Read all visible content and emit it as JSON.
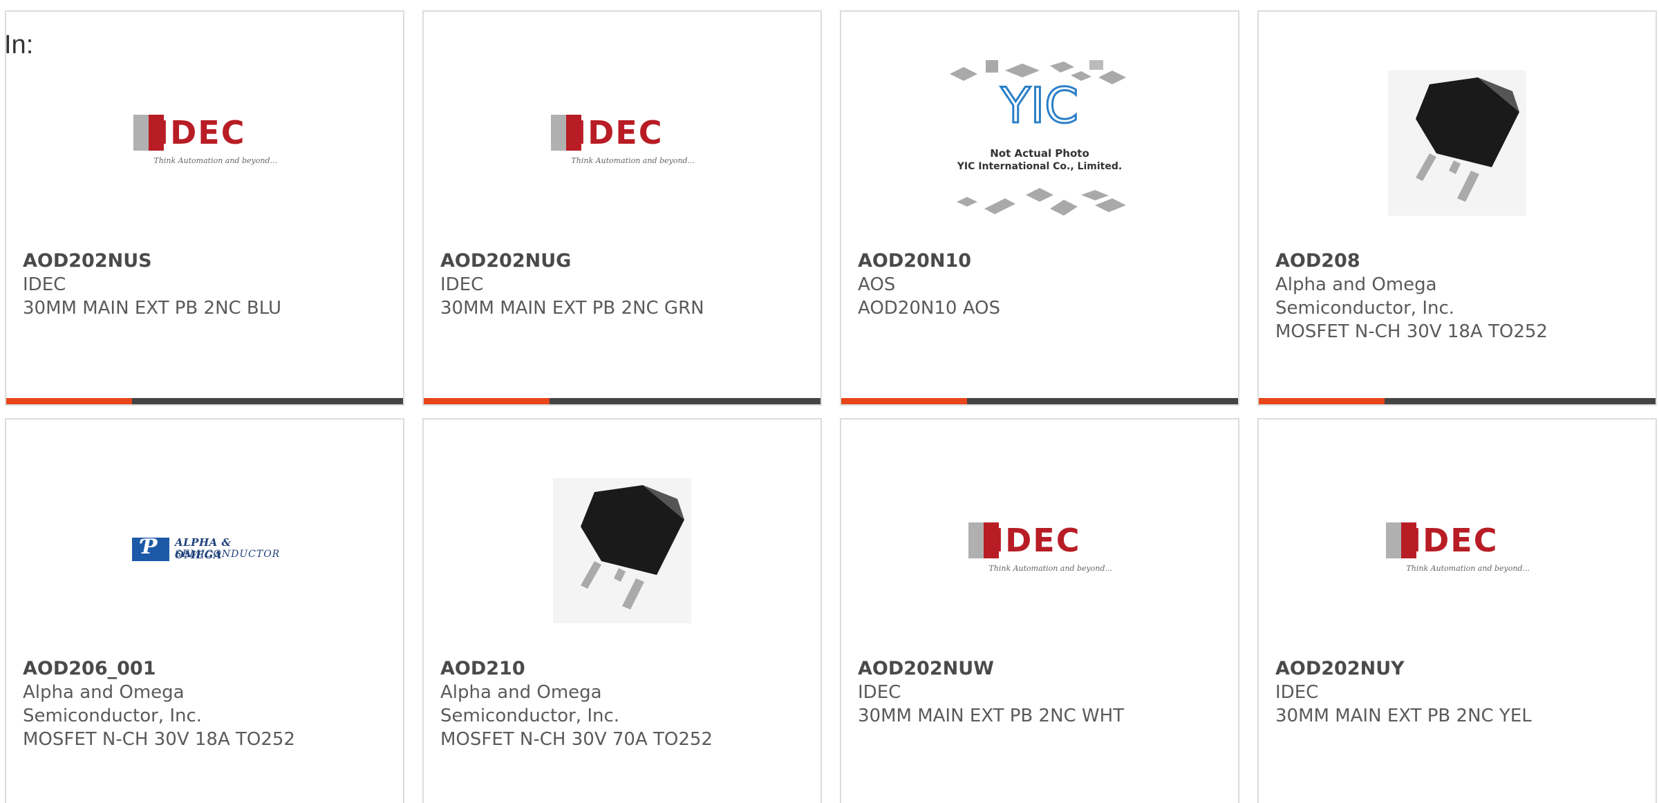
{
  "header": {
    "label": "In:"
  },
  "cards": [
    {
      "part": "AOD202NUS",
      "maker": "IDEC",
      "desc": "30MM MAIN EXT PB 2NC BLU",
      "image": "idec-logo"
    },
    {
      "part": "AOD202NUG",
      "maker": "IDEC",
      "desc": "30MM MAIN EXT PB 2NC GRN",
      "image": "idec-logo"
    },
    {
      "part": "AOD20N10",
      "maker": "AOS",
      "desc": "AOD20N10 AOS",
      "image": "yic-placeholder"
    },
    {
      "part": "AOD208",
      "maker": "Alpha and Omega Semiconductor, Inc.",
      "desc": "MOSFET N-CH 30V 18A TO252",
      "image": "to252-package"
    },
    {
      "part": "AOD206_001",
      "maker": "Alpha and Omega Semiconductor, Inc.",
      "desc": "MOSFET N-CH 30V 18A TO252",
      "image": "alpha-omega-logo"
    },
    {
      "part": "AOD210",
      "maker": "Alpha and Omega Semiconductor, Inc.",
      "desc": "MOSFET N-CH 30V 70A TO252",
      "image": "to252-package"
    },
    {
      "part": "AOD202NUW",
      "maker": "IDEC",
      "desc": "30MM MAIN EXT PB 2NC WHT",
      "image": "idec-logo"
    },
    {
      "part": "AOD202NUY",
      "maker": "IDEC",
      "desc": "30MM MAIN EXT PB 2NC YEL",
      "image": "idec-logo"
    }
  ],
  "logos": {
    "idec_word": "IDEC",
    "idec_tagline": "Think Automation and beyond...",
    "yic_mark": "YIC",
    "yic_line1": "Not Actual Photo",
    "yic_line2": "YIC International Co., Limited.",
    "ao_line1": "ALPHA & OMEGA",
    "ao_line2": "SEMICONDUCTOR"
  },
  "colors": {
    "accent": "#e8461a",
    "bar": "#444444",
    "idec_red": "#b81d25",
    "ao_blue": "#1c5aa8"
  }
}
